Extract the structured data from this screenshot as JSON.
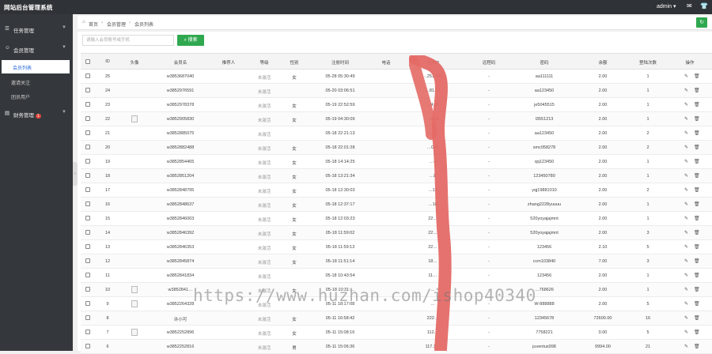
{
  "app": {
    "title": "网站后台管理系统",
    "user": "admin"
  },
  "sidebar": {
    "groups": [
      {
        "label": "任务管理"
      },
      {
        "label": "会员管理",
        "items": [
          "会员列表",
          "邀请关注",
          "团员用户"
        ]
      },
      {
        "label": "财务管理",
        "badge": "1"
      }
    ]
  },
  "breadcrumb": [
    "首页",
    "会员管理",
    "会员列表"
  ],
  "search": {
    "placeholder": "请输入会员账号或手机",
    "button": "搜索"
  },
  "table": {
    "columns": [
      "ID",
      "头像",
      "会员名",
      "推荐人",
      "等级",
      "性别",
      "注册时间",
      "电话",
      "注册IP",
      "远程码",
      "密码",
      "余额",
      "登陆次数",
      "操作"
    ],
    "rows": [
      {
        "id": "25",
        "avatar": false,
        "name": "w3853687040",
        "level": "未激活",
        "gender": "女",
        "time": "05-28 05:30:49",
        "ip": "…251.145",
        "remote": "-",
        "password": "aa111111",
        "balance": "2.00",
        "logins": "1"
      },
      {
        "id": "24",
        "avatar": false,
        "name": "w3852976591",
        "level": "未激活",
        "gender": "",
        "time": "05-20 03:06:51",
        "ip": "…81.21",
        "remote": "-",
        "password": "aa123450",
        "balance": "2.00",
        "logins": "1"
      },
      {
        "id": "23",
        "avatar": false,
        "name": "w3852978378",
        "level": "未激活",
        "gender": "女",
        "time": "05-19 22:52:59",
        "ip": "…4.86",
        "remote": "-",
        "password": "je5045515",
        "balance": "2.00",
        "logins": "1"
      },
      {
        "id": "22",
        "avatar": true,
        "name": "w3852905830",
        "level": "未激活",
        "gender": "女",
        "time": "05-19 04:30:09",
        "ip": "…4.00",
        "remote": "-",
        "password": "l3551213",
        "balance": "2.00",
        "logins": "1"
      },
      {
        "id": "21",
        "avatar": false,
        "name": "w3852885075",
        "level": "未激活",
        "gender": "",
        "time": "05-18 22:21:13",
        "ip": "…52",
        "remote": "-",
        "password": "aa123450",
        "balance": "2.00",
        "logins": "2"
      },
      {
        "id": "20",
        "avatar": false,
        "name": "w3852882488",
        "level": "未激活",
        "gender": "女",
        "time": "05-18 22:01:28",
        "ip": "…045",
        "remote": "-",
        "password": "smc058278",
        "balance": "2.00",
        "logins": "2"
      },
      {
        "id": "19",
        "avatar": false,
        "name": "w3852854465",
        "level": "未激活",
        "gender": "女",
        "time": "05-18 14:14:25",
        "ip": "…4",
        "remote": "-",
        "password": "qq123450",
        "balance": "2.00",
        "logins": "1"
      },
      {
        "id": "18",
        "avatar": false,
        "name": "w3852851204",
        "level": "未激活",
        "gender": "女",
        "time": "05-18 13:21:34",
        "ip": "…8",
        "remote": "-",
        "password": "123450780",
        "balance": "2.00",
        "logins": "1"
      },
      {
        "id": "17",
        "avatar": false,
        "name": "w3852848795",
        "level": "未激活",
        "gender": "女",
        "time": "05-18 12:30:03",
        "ip": "…13",
        "remote": "-",
        "password": "yqj19881010",
        "balance": "2.00",
        "logins": "2"
      },
      {
        "id": "16",
        "avatar": false,
        "name": "w3852848637",
        "level": "未激活",
        "gender": "女",
        "time": "05-18 12:37:17",
        "ip": "…18",
        "remote": "-",
        "password": "zhang2228yuuuu",
        "balance": "2.00",
        "logins": "1"
      },
      {
        "id": "15",
        "avatar": false,
        "name": "w3852846003",
        "level": "未激活",
        "gender": "女",
        "time": "05-18 12:03:23",
        "ip": "22…",
        "remote": "-",
        "password": "520yoyajajmnt",
        "balance": "2.00",
        "logins": "1"
      },
      {
        "id": "14",
        "avatar": false,
        "name": "w3852846392",
        "level": "未激活",
        "gender": "女",
        "time": "05-18 11:59:02",
        "ip": "22…",
        "remote": "-",
        "password": "520yoyajajmnt",
        "balance": "2.00",
        "logins": "3"
      },
      {
        "id": "13",
        "avatar": false,
        "name": "w3852846353",
        "level": "未激活",
        "gender": "女",
        "time": "05-18 11:59:13",
        "ip": "22…",
        "remote": "-",
        "password": "123456",
        "balance": "2.10",
        "logins": "5"
      },
      {
        "id": "12",
        "avatar": false,
        "name": "w3852845874",
        "level": "未激活",
        "gender": "女",
        "time": "05-18 11:51:14",
        "ip": "18…",
        "remote": "-",
        "password": "ccm103840",
        "balance": "7.00",
        "logins": "3"
      },
      {
        "id": "11",
        "avatar": false,
        "name": "w3852841834",
        "level": "未激活",
        "gender": "",
        "time": "05-18 10:43:54",
        "ip": "11…",
        "remote": "-",
        "password": "123456",
        "balance": "2.00",
        "logins": "1"
      },
      {
        "id": "10",
        "avatar": true,
        "name": "w3852841…",
        "level": "未激活",
        "gender": "女",
        "time": "05-18 10:31:…",
        "ip": "…",
        "remote": "-",
        "password": "…768626",
        "balance": "2.00",
        "logins": "1"
      },
      {
        "id": "9",
        "avatar": true,
        "name": "w3852264328",
        "level": "未激活",
        "gender": "",
        "time": "05-11 18:17:08",
        "ip": "…",
        "remote": "-",
        "password": "W-888888",
        "balance": "2.00",
        "logins": "5"
      },
      {
        "id": "8",
        "avatar": false,
        "name": "许小可",
        "level": "未激活",
        "gender": "女",
        "time": "05-11 16:58:42",
        "ip": "222…",
        "remote": "-",
        "password": "12345678",
        "balance": "72600.00",
        "logins": "16"
      },
      {
        "id": "7",
        "avatar": true,
        "name": "w3852252896",
        "level": "未激活",
        "gender": "女",
        "time": "05-11 15:08:16",
        "ip": "112…",
        "remote": "-",
        "password": "7758221",
        "balance": "0.00",
        "logins": "5"
      },
      {
        "id": "6",
        "avatar": false,
        "name": "w3852252816",
        "level": "未激活",
        "gender": "男",
        "time": "05-11 15:06:36",
        "ip": "117.1…",
        "remote": "-",
        "password": "juventus998",
        "balance": "9994.00",
        "logins": "21"
      }
    ]
  },
  "watermark": "https://www.huzhan.com/ishop40340",
  "colors": {
    "topbar": "#2f3236",
    "sidebar": "#34383c",
    "accent": "#2fa84f",
    "link": "#2b6cd8"
  },
  "icons": [
    "home-icon",
    "refresh-icon",
    "mail-icon",
    "shirt-icon",
    "edit-icon",
    "delete-icon"
  ]
}
